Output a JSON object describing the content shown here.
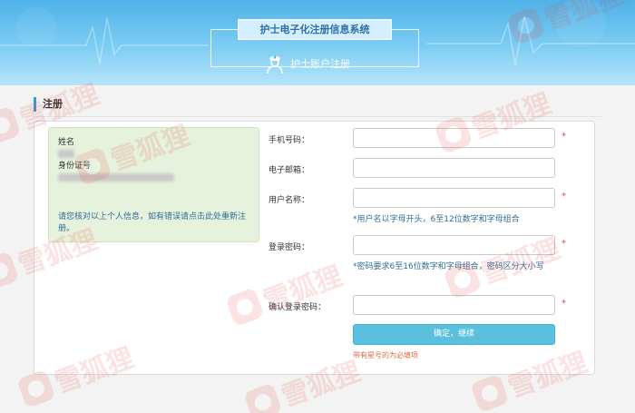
{
  "header": {
    "system_title": "护士电子化注册信息系统",
    "subtitle": "护士账户注册"
  },
  "section": {
    "title": "注册"
  },
  "info": {
    "name_label": "姓名",
    "id_label": "身份证号",
    "note": "请您核对以上个人信息，如有错误请点击此处重新注册。"
  },
  "form": {
    "phone_label": "手机号码：",
    "email_label": "电子邮箱：",
    "username_label": "用户名称：",
    "username_hint": "*用户名以字母开头，6至12位数字和字母组合",
    "password_label": "登录密码：",
    "password_hint": "*密码要求6至16位数字和字母组合，密码区分大小写",
    "confirm_label": "确认登录密码：",
    "required_mark": "*",
    "submit_label": "确定，继续",
    "required_note": "带有星号的为必填项"
  },
  "watermark": {
    "text": "雪狐狸"
  },
  "colors": {
    "accent": "#3a9bd8",
    "button": "#5bc0de",
    "required": "#e04a4a",
    "info_bg": "#e6f2dc"
  }
}
